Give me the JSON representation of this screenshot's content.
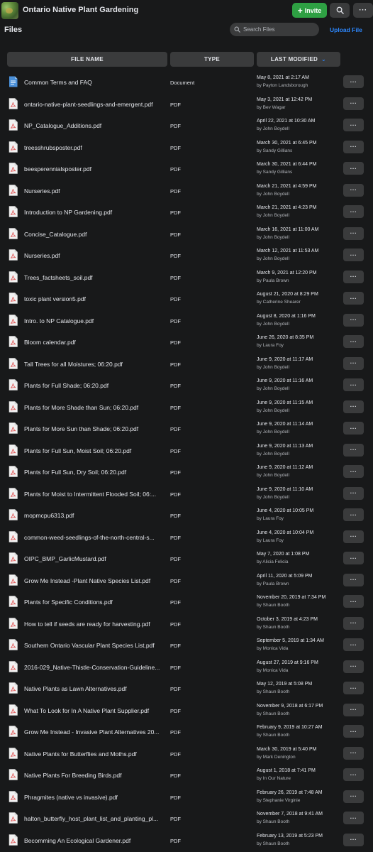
{
  "header": {
    "group_name": "Ontario Native Plant Gardening",
    "invite_label": "Invite",
    "more_label": "···"
  },
  "files_bar": {
    "title": "Files",
    "search_placeholder": "Search Files",
    "upload_label": "Upload File"
  },
  "columns": {
    "name": "FILE NAME",
    "type": "TYPE",
    "modified": "LAST MODIFIED"
  },
  "colors": {
    "accent": "#2d88ff",
    "invite": "#2ea043",
    "pdf_icon": "#e05a5a",
    "doc_icon": "#4a90d9"
  },
  "row_more_label": "···",
  "files": [
    {
      "name": "Common Terms and FAQ",
      "type": "Document",
      "date": "May 8, 2021 at 2:17 AM",
      "by": "by Payton Landsborough",
      "icon": "doc"
    },
    {
      "name": "ontario-native-plant-seedlings-and-emergent.pdf",
      "type": "PDF",
      "date": "May 3, 2021 at 12:42 PM",
      "by": "by Bev Wagar",
      "icon": "pdf"
    },
    {
      "name": "NP_Catalogue_Additions.pdf",
      "type": "PDF",
      "date": "April 22, 2021 at 10:30 AM",
      "by": "by John Boydell",
      "icon": "pdf"
    },
    {
      "name": "treesshrubsposter.pdf",
      "type": "PDF",
      "date": "March 30, 2021 at 6:45 PM",
      "by": "by Sandy Gillians",
      "icon": "pdf"
    },
    {
      "name": "beesperennialsposter.pdf",
      "type": "PDF",
      "date": "March 30, 2021 at 6:44 PM",
      "by": "by Sandy Gillians",
      "icon": "pdf"
    },
    {
      "name": "Nurseries.pdf",
      "type": "PDF",
      "date": "March 21, 2021 at 4:59 PM",
      "by": "by John Boydell",
      "icon": "pdf"
    },
    {
      "name": "Introduction to NP Gardening.pdf",
      "type": "PDF",
      "date": "March 21, 2021 at 4:23 PM",
      "by": "by John Boydell",
      "icon": "pdf"
    },
    {
      "name": "Concise_Catalogue.pdf",
      "type": "PDF",
      "date": "March 16, 2021 at 11:00 AM",
      "by": "by John Boydell",
      "icon": "pdf"
    },
    {
      "name": "Nurseries.pdf",
      "type": "PDF",
      "date": "March 12, 2021 at 11:53 AM",
      "by": "by John Boydell",
      "icon": "pdf"
    },
    {
      "name": "Trees_factsheets_soil.pdf",
      "type": "PDF",
      "date": "March 9, 2021 at 12:20 PM",
      "by": "by Paula Brown",
      "icon": "pdf"
    },
    {
      "name": "toxic plant version5.pdf",
      "type": "PDF",
      "date": "August 21, 2020 at 8:29 PM",
      "by": "by Catherine Shearer",
      "icon": "pdf"
    },
    {
      "name": "Intro. to NP Catalogue.pdf",
      "type": "PDF",
      "date": "August 8, 2020 at 1:16 PM",
      "by": "by John Boydell",
      "icon": "pdf"
    },
    {
      "name": "Bloom calendar.pdf",
      "type": "PDF",
      "date": "June 26, 2020 at 8:35 PM",
      "by": "by Laura Foy",
      "icon": "pdf"
    },
    {
      "name": "Tall Trees for all Moistures; 06:20.pdf",
      "type": "PDF",
      "date": "June 9, 2020 at 11:17 AM",
      "by": "by John Boydell",
      "icon": "pdf"
    },
    {
      "name": "Plants for Full Shade; 06:20.pdf",
      "type": "PDF",
      "date": "June 9, 2020 at 11:16 AM",
      "by": "by John Boydell",
      "icon": "pdf"
    },
    {
      "name": "Plants for More Shade than Sun; 06:20.pdf",
      "type": "PDF",
      "date": "June 9, 2020 at 11:15 AM",
      "by": "by John Boydell",
      "icon": "pdf"
    },
    {
      "name": "Plants for More Sun than Shade; 06:20.pdf",
      "type": "PDF",
      "date": "June 9, 2020 at 11:14 AM",
      "by": "by John Boydell",
      "icon": "pdf"
    },
    {
      "name": "Plants for Full Sun, Moist Soil; 06:20.pdf",
      "type": "PDF",
      "date": "June 9, 2020 at 11:13 AM",
      "by": "by John Boydell",
      "icon": "pdf"
    },
    {
      "name": "Plants for Full Sun, Dry Soil; 06:20.pdf",
      "type": "PDF",
      "date": "June 9, 2020 at 11:12 AM",
      "by": "by John Boydell",
      "icon": "pdf"
    },
    {
      "name": "Plants for Moist to Intermittent Flooded Soil; 06:...",
      "type": "PDF",
      "date": "June 9, 2020 at 11:10 AM",
      "by": "by John Boydell",
      "icon": "pdf"
    },
    {
      "name": "mopmcpu6313.pdf",
      "type": "PDF",
      "date": "June 4, 2020 at 10:05 PM",
      "by": "by Laura Foy",
      "icon": "pdf"
    },
    {
      "name": "common-weed-seedlings-of-the-north-central-s...",
      "type": "PDF",
      "date": "June 4, 2020 at 10:04 PM",
      "by": "by Laura Foy",
      "icon": "pdf"
    },
    {
      "name": "OIPC_BMP_GarlicMustard.pdf",
      "type": "PDF",
      "date": "May 7, 2020 at 1:08 PM",
      "by": "by Alicia Felicia",
      "icon": "pdf"
    },
    {
      "name": "Grow Me Instead -Plant Native Species List.pdf",
      "type": "PDF",
      "date": "April 11, 2020 at 5:09 PM",
      "by": "by Paula Brown",
      "icon": "pdf"
    },
    {
      "name": "Plants for Specific Conditions.pdf",
      "type": "PDF",
      "date": "November 20, 2019 at 7:34 PM",
      "by": "by Shaun Booth",
      "icon": "pdf"
    },
    {
      "name": "How to tell if seeds are ready for harvesting.pdf",
      "type": "PDF",
      "date": "October 3, 2019 at 4:23 PM",
      "by": "by Shaun Booth",
      "icon": "pdf"
    },
    {
      "name": "Southern Ontario Vascular Plant Species List.pdf",
      "type": "PDF",
      "date": "September 5, 2019 at 1:34 AM",
      "by": "by Monica Vida",
      "icon": "pdf"
    },
    {
      "name": "2016-029_Native-Thistle-Conservation-Guideline...",
      "type": "PDF",
      "date": "August 27, 2019 at 9:16 PM",
      "by": "by Monica Vida",
      "icon": "pdf"
    },
    {
      "name": "Native Plants as Lawn Alternatives.pdf",
      "type": "PDF",
      "date": "May 12, 2019 at 5:08 PM",
      "by": "by Shaun Booth",
      "icon": "pdf"
    },
    {
      "name": "What To Look for In A Native Plant Supplier.pdf",
      "type": "PDF",
      "date": "November 9, 2018 at 6:17 PM",
      "by": "by Shaun Booth",
      "icon": "pdf"
    },
    {
      "name": "Grow Me Instead - Invasive Plant Alternatives 20...",
      "type": "PDF",
      "date": "February 9, 2019 at 10:27 AM",
      "by": "by Shaun Booth",
      "icon": "pdf"
    },
    {
      "name": "Native Plants for Butterflies and Moths.pdf",
      "type": "PDF",
      "date": "March 30, 2019 at 5:40 PM",
      "by": "by Mark Denington",
      "icon": "pdf"
    },
    {
      "name": "Native Plants For Breeding Birds.pdf",
      "type": "PDF",
      "date": "August 1, 2018 at 7:41 PM",
      "by": "by In Our Nature",
      "icon": "pdf"
    },
    {
      "name": "Phragmites (native vs invasive).pdf",
      "type": "PDF",
      "date": "February 26, 2019 at 7:48 AM",
      "by": "by Stephanie Virginie",
      "icon": "pdf"
    },
    {
      "name": "halton_butterfly_host_plant_list_and_planting_pl...",
      "type": "PDF",
      "date": "November 7, 2018 at 9:41 AM",
      "by": "by Shaun Booth",
      "icon": "pdf"
    },
    {
      "name": "Becomming An Ecological Gardener.pdf",
      "type": "PDF",
      "date": "February 13, 2019 at 5:23 PM",
      "by": "by Shaun Booth",
      "icon": "pdf"
    }
  ]
}
